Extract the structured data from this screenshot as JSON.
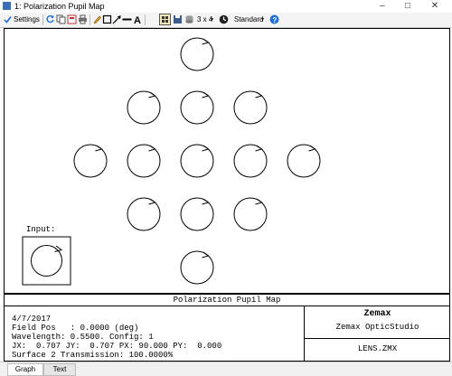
{
  "window": {
    "title": "1: Polarization Pupil Map"
  },
  "toolbar": {
    "settings_label": "Settings",
    "layout_label": "3 x 4",
    "standard_label": "Standard"
  },
  "graph": {
    "input_label": "Input:",
    "ellipses": [
      {
        "row": 0,
        "col": 2
      },
      {
        "row": 1,
        "col": 1
      },
      {
        "row": 1,
        "col": 2
      },
      {
        "row": 1,
        "col": 3
      },
      {
        "row": 2,
        "col": 0
      },
      {
        "row": 2,
        "col": 1
      },
      {
        "row": 2,
        "col": 2
      },
      {
        "row": 2,
        "col": 3
      },
      {
        "row": 2,
        "col": 4
      },
      {
        "row": 3,
        "col": 1
      },
      {
        "row": 3,
        "col": 2
      },
      {
        "row": 3,
        "col": 3
      },
      {
        "row": 4,
        "col": 2
      }
    ]
  },
  "info": {
    "title": "Polarization Pupil Map",
    "date": "4/7/2017",
    "field_pos": "Field Pos   : 0.0000 (deg)",
    "wavelength": "Wavelength: 0.5500. Config: 1",
    "jones": "JX:  0.707 JY:  0.707 PX: 90.000 PY:  0.000",
    "transmission": "Surface 2 Transmission: 100.0000%",
    "brand": "Zemax",
    "product": "Zemax OpticStudio",
    "file": "LENS.ZMX"
  },
  "tabs": [
    {
      "label": "Graph"
    },
    {
      "label": "Text"
    }
  ],
  "colors": {
    "accent": "#1e6fd9"
  }
}
